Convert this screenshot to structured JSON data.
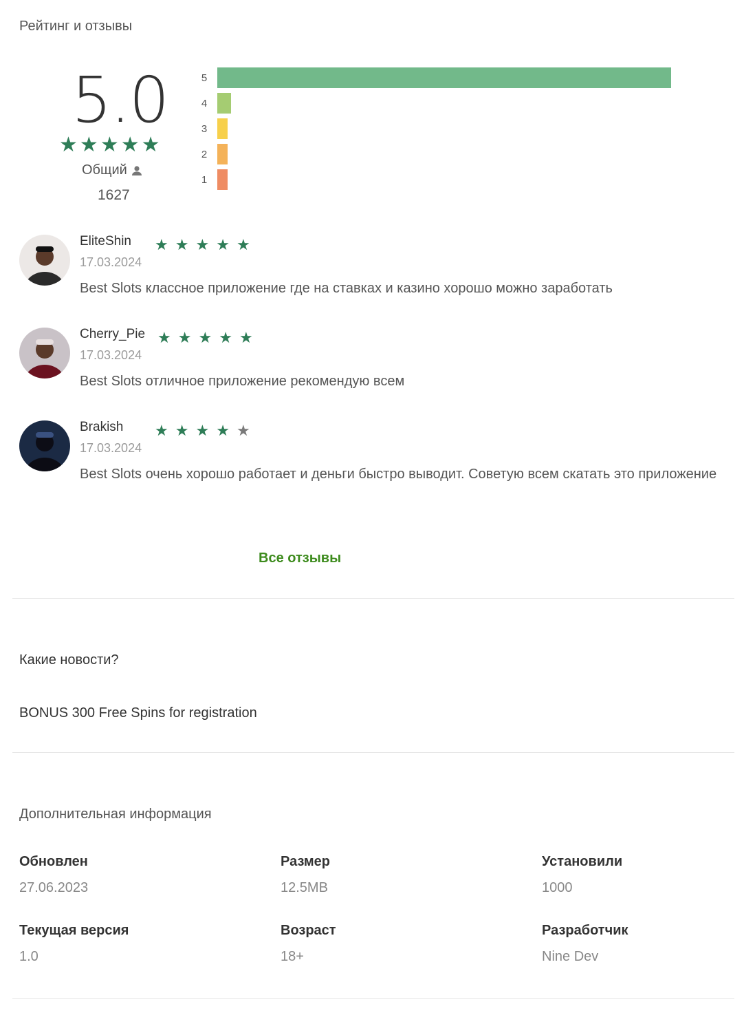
{
  "rating": {
    "section_title": "Рейтинг и отзывы",
    "score": "5.0",
    "stars": 5,
    "total_label": "Общий",
    "total_count": "1627",
    "histogram": [
      {
        "label": "5",
        "fraction": 1.0,
        "color": "#72b98a"
      },
      {
        "label": "4",
        "fraction": 0.03,
        "color": "#a5cc72"
      },
      {
        "label": "3",
        "fraction": 0.023,
        "color": "#f7d04b"
      },
      {
        "label": "2",
        "fraction": 0.023,
        "color": "#f4b259"
      },
      {
        "label": "1",
        "fraction": 0.023,
        "color": "#ef8c63"
      }
    ]
  },
  "reviews": [
    {
      "name": "EliteShin",
      "date": "17.03.2024",
      "stars": 5,
      "text": "Best Slots классное приложение где на ставках и казино хорошо можно заработать"
    },
    {
      "name": "Cherry_Pie",
      "date": "17.03.2024",
      "stars": 5,
      "text": "Best Slots отличное приложение рекомендую всем"
    },
    {
      "name": "Brakish",
      "date": "17.03.2024",
      "stars": 4,
      "text": "Best Slots очень хорошо работает и деньги быстро выводит. Советую всем скатать это приложение"
    }
  ],
  "all_reviews_link": "Все отзывы",
  "whats_new": {
    "title": "Какие новости?",
    "text": "BONUS 300 Free Spins for registration"
  },
  "additional_info": {
    "title": "Дополнительная информация",
    "items": [
      {
        "label": "Обновлен",
        "value": "27.06.2023"
      },
      {
        "label": "Размер",
        "value": "12.5MB"
      },
      {
        "label": "Установили",
        "value": "1000"
      },
      {
        "label": "Текущая версия",
        "value": "1.0"
      },
      {
        "label": "Возраст",
        "value": "18+"
      },
      {
        "label": "Разработчик",
        "value": "Nine Dev"
      }
    ]
  },
  "colors": {
    "star": "#2e7d57",
    "star_empty": "#7a7a7a",
    "link": "#3d8b1d"
  }
}
